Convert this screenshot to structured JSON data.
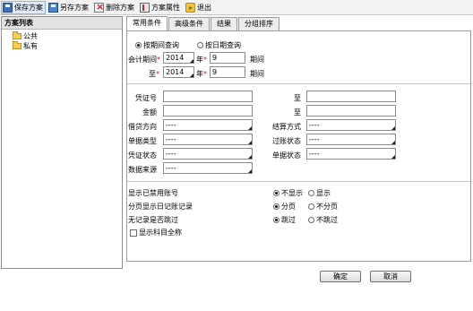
{
  "toolbar": {
    "save_label": "保存方案",
    "saveas_label": "另存方案",
    "delete_label": "删除方案",
    "props_label": "方案属性",
    "exit_label": "退出"
  },
  "left_panel": {
    "title": "方案列表",
    "items": [
      "公共",
      "私有"
    ]
  },
  "tabs": [
    "常用条件",
    "高级条件",
    "结果",
    "分组排序"
  ],
  "form": {
    "query_by_period": "按期间查询",
    "query_by_date": "按日期查询",
    "period_label": "会计期间",
    "to_label": "至",
    "year_label": "年",
    "period_suffix": "期间",
    "from_year": "2014",
    "from_period": "9",
    "to_year": "2014",
    "to_period": "9",
    "voucher_no": "凭证号",
    "amount": "金额",
    "range_to": "至",
    "debit_credit": "借贷方向",
    "doc_type": "单据类型",
    "voucher_status": "凭证状态",
    "data_source": "数据来源",
    "settle_method": "结算方式",
    "posting_status": "过账状态",
    "doc_status": "单据状态",
    "dash": "----",
    "show_disabled": "显示已禁用账号",
    "paginate_journal": "分页显示日记账记录",
    "skip_no_records": "无记录是否跳过",
    "show_full_name": "显示科目全称",
    "opt_hide": "不显示",
    "opt_show": "显示",
    "opt_paginate": "分页",
    "opt_no_paginate": "不分页",
    "opt_skip": "跳过",
    "opt_no_skip": "不跳过"
  },
  "footer": {
    "ok_label": "确定",
    "cancel_label": "取消"
  }
}
